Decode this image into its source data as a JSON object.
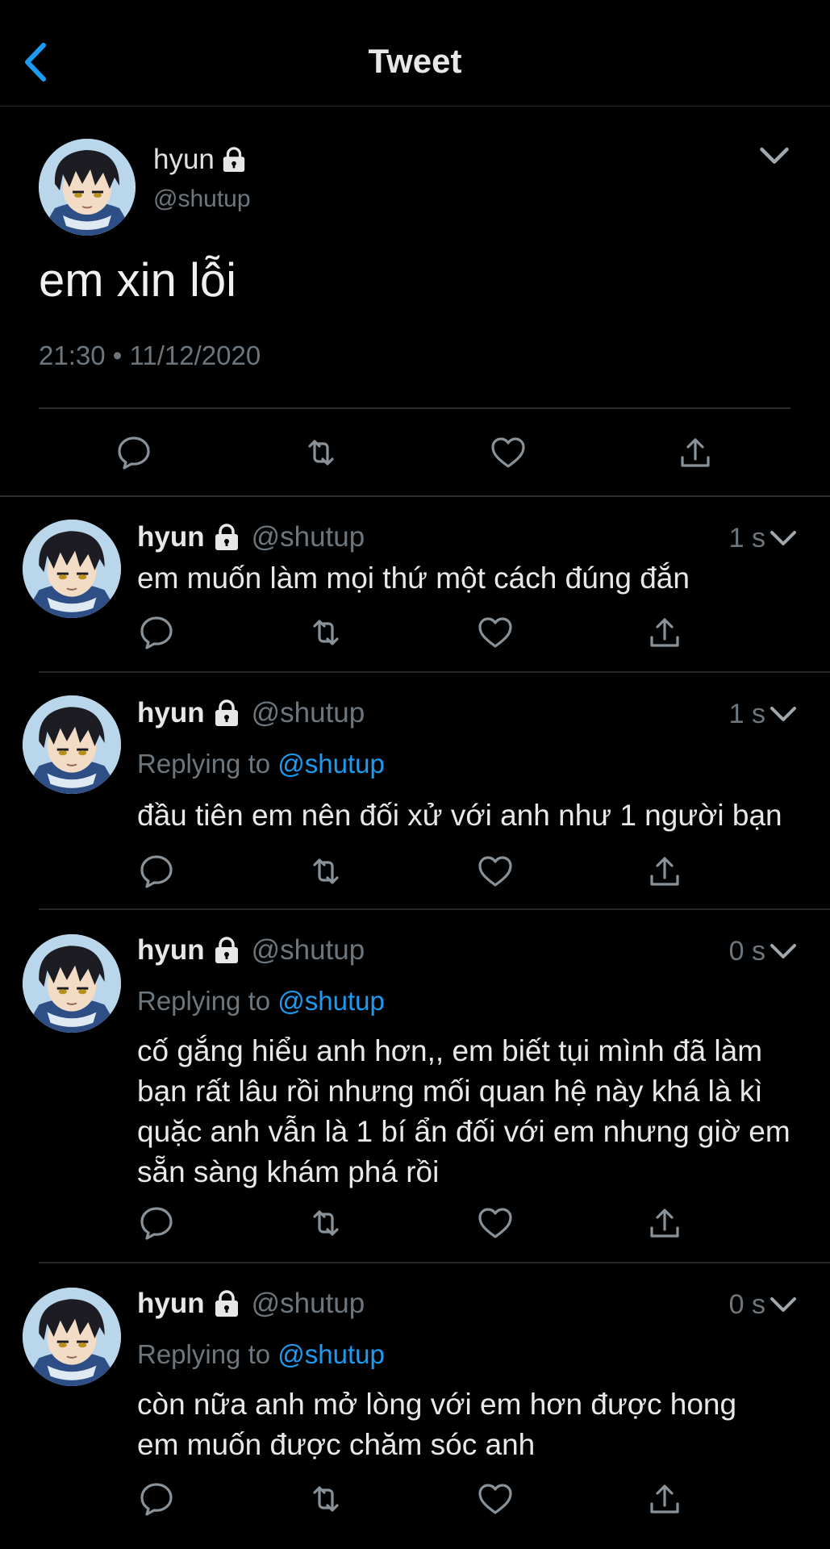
{
  "header": {
    "title": "Tweet",
    "back_icon": "chevron-left-icon"
  },
  "main_tweet": {
    "name": "hyun",
    "handle": "@shutup",
    "text": "em xin lỗi",
    "timestamp": "21:30 • 11/12/2020"
  },
  "replies": [
    {
      "name": "hyun",
      "handle": "@shutup",
      "time": "1 s",
      "text": "em muốn làm mọi thứ một cách đúng đắn"
    },
    {
      "name": "hyun",
      "handle": "@shutup",
      "time": "1 s",
      "replying_label": "Replying to",
      "replying_to": "@shutup",
      "text": "đầu tiên em nên đối xử với anh như 1 người bạn"
    },
    {
      "name": "hyun",
      "handle": "@shutup",
      "time": "0 s",
      "replying_label": "Replying to",
      "replying_to": "@shutup",
      "text_lines": [
        "cố gắng hiểu anh hơn,, em biết tụi mình đã làm",
        "bạn rất lâu rồi nhưng mối quan hệ này khá là kì",
        "quặc anh vẫn là 1 bí ẩn đối với em nhưng giờ em",
        "sẵn sàng khám phá rồi"
      ]
    },
    {
      "name": "hyun",
      "handle": "@shutup",
      "time": "0 s",
      "replying_label": "Replying to",
      "replying_to": "@shutup",
      "text_lines": [
        "còn nữa anh mở lòng với em hơn được hong",
        "em muốn được chăm sóc anh"
      ]
    }
  ],
  "colors": {
    "background": "#000000",
    "accent": "#1d9bf0",
    "secondary_text": "#6e767d"
  }
}
